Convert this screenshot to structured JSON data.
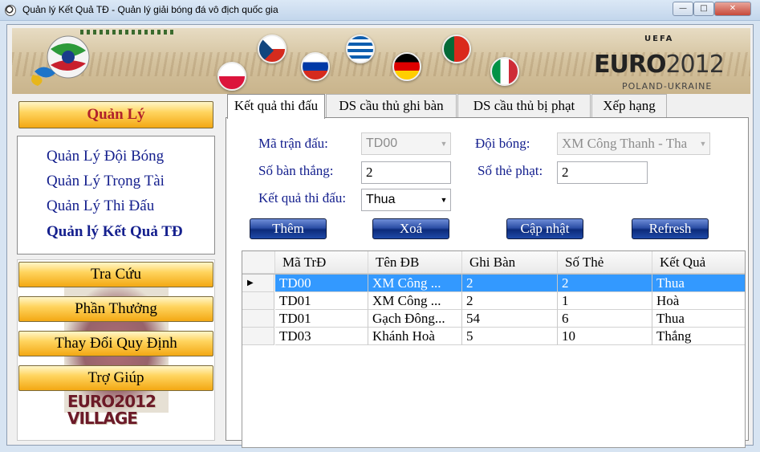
{
  "window": {
    "title": "Quản lý Kết Quả TĐ - Quản lý giải bóng đá vô địch quốc gia",
    "minimize": "—",
    "maximize": "□",
    "close": "✕"
  },
  "banner": {
    "uefa": "UEFA",
    "euro": "EURO",
    "year": "2012",
    "host": "POLAND-UKRAINE"
  },
  "nav": {
    "header": "Quản Lý",
    "links": [
      "Quản Lý Đội Bóng",
      "Quản Lý Trọng Tài",
      "Quản Lý Thi Đấu",
      "Quản lý Kết Quả TĐ"
    ],
    "items": [
      "Tra Cứu",
      "Phần Thưởng",
      "Thay Đổi Quy Định",
      "Trợ Giúp"
    ],
    "village_logo_line1": "EURO2012",
    "village_logo_line2": "VILLAGE"
  },
  "tabs": [
    "Kết quả thi đấu",
    "DS cầu thủ ghi bàn",
    "DS cầu thủ bị phạt",
    "Xếp hạng"
  ],
  "form": {
    "match_id_label": "Mã trận đấu:",
    "match_id_value": "TD00",
    "team_label": "Đội bóng:",
    "team_value": "XM Công Thanh - Tha",
    "goals_label": "Số bàn thắng:",
    "goals_value": "2",
    "cards_label": "Số thẻ phạt:",
    "cards_value": "2",
    "result_label": "Kết quả thi đấu:",
    "result_value": "Thua"
  },
  "buttons": {
    "add": "Thêm",
    "delete": "Xoá",
    "update": "Cập nhật",
    "refresh": "Refresh"
  },
  "grid": {
    "columns": [
      "Mã TrĐ",
      "Tên ĐB",
      "Ghi Bàn",
      "Số Thẻ",
      "Kết Quả"
    ],
    "rows": [
      [
        "TD00",
        "XM Công ...",
        "2",
        "2",
        "Thua"
      ],
      [
        "TD01",
        "XM Công ...",
        "2",
        "1",
        "Hoà"
      ],
      [
        "TD01",
        "Gạch Đông...",
        "54",
        "6",
        "Thua"
      ],
      [
        "TD03",
        "Khánh Hoà",
        "5",
        "10",
        "Thắng"
      ]
    ],
    "selected_row_marker": "▶"
  },
  "colors": {
    "accent_blue": "#15208e",
    "nav_gold": "#ffd45e",
    "selection": "#3399ff",
    "header_red": "#b0222c"
  }
}
